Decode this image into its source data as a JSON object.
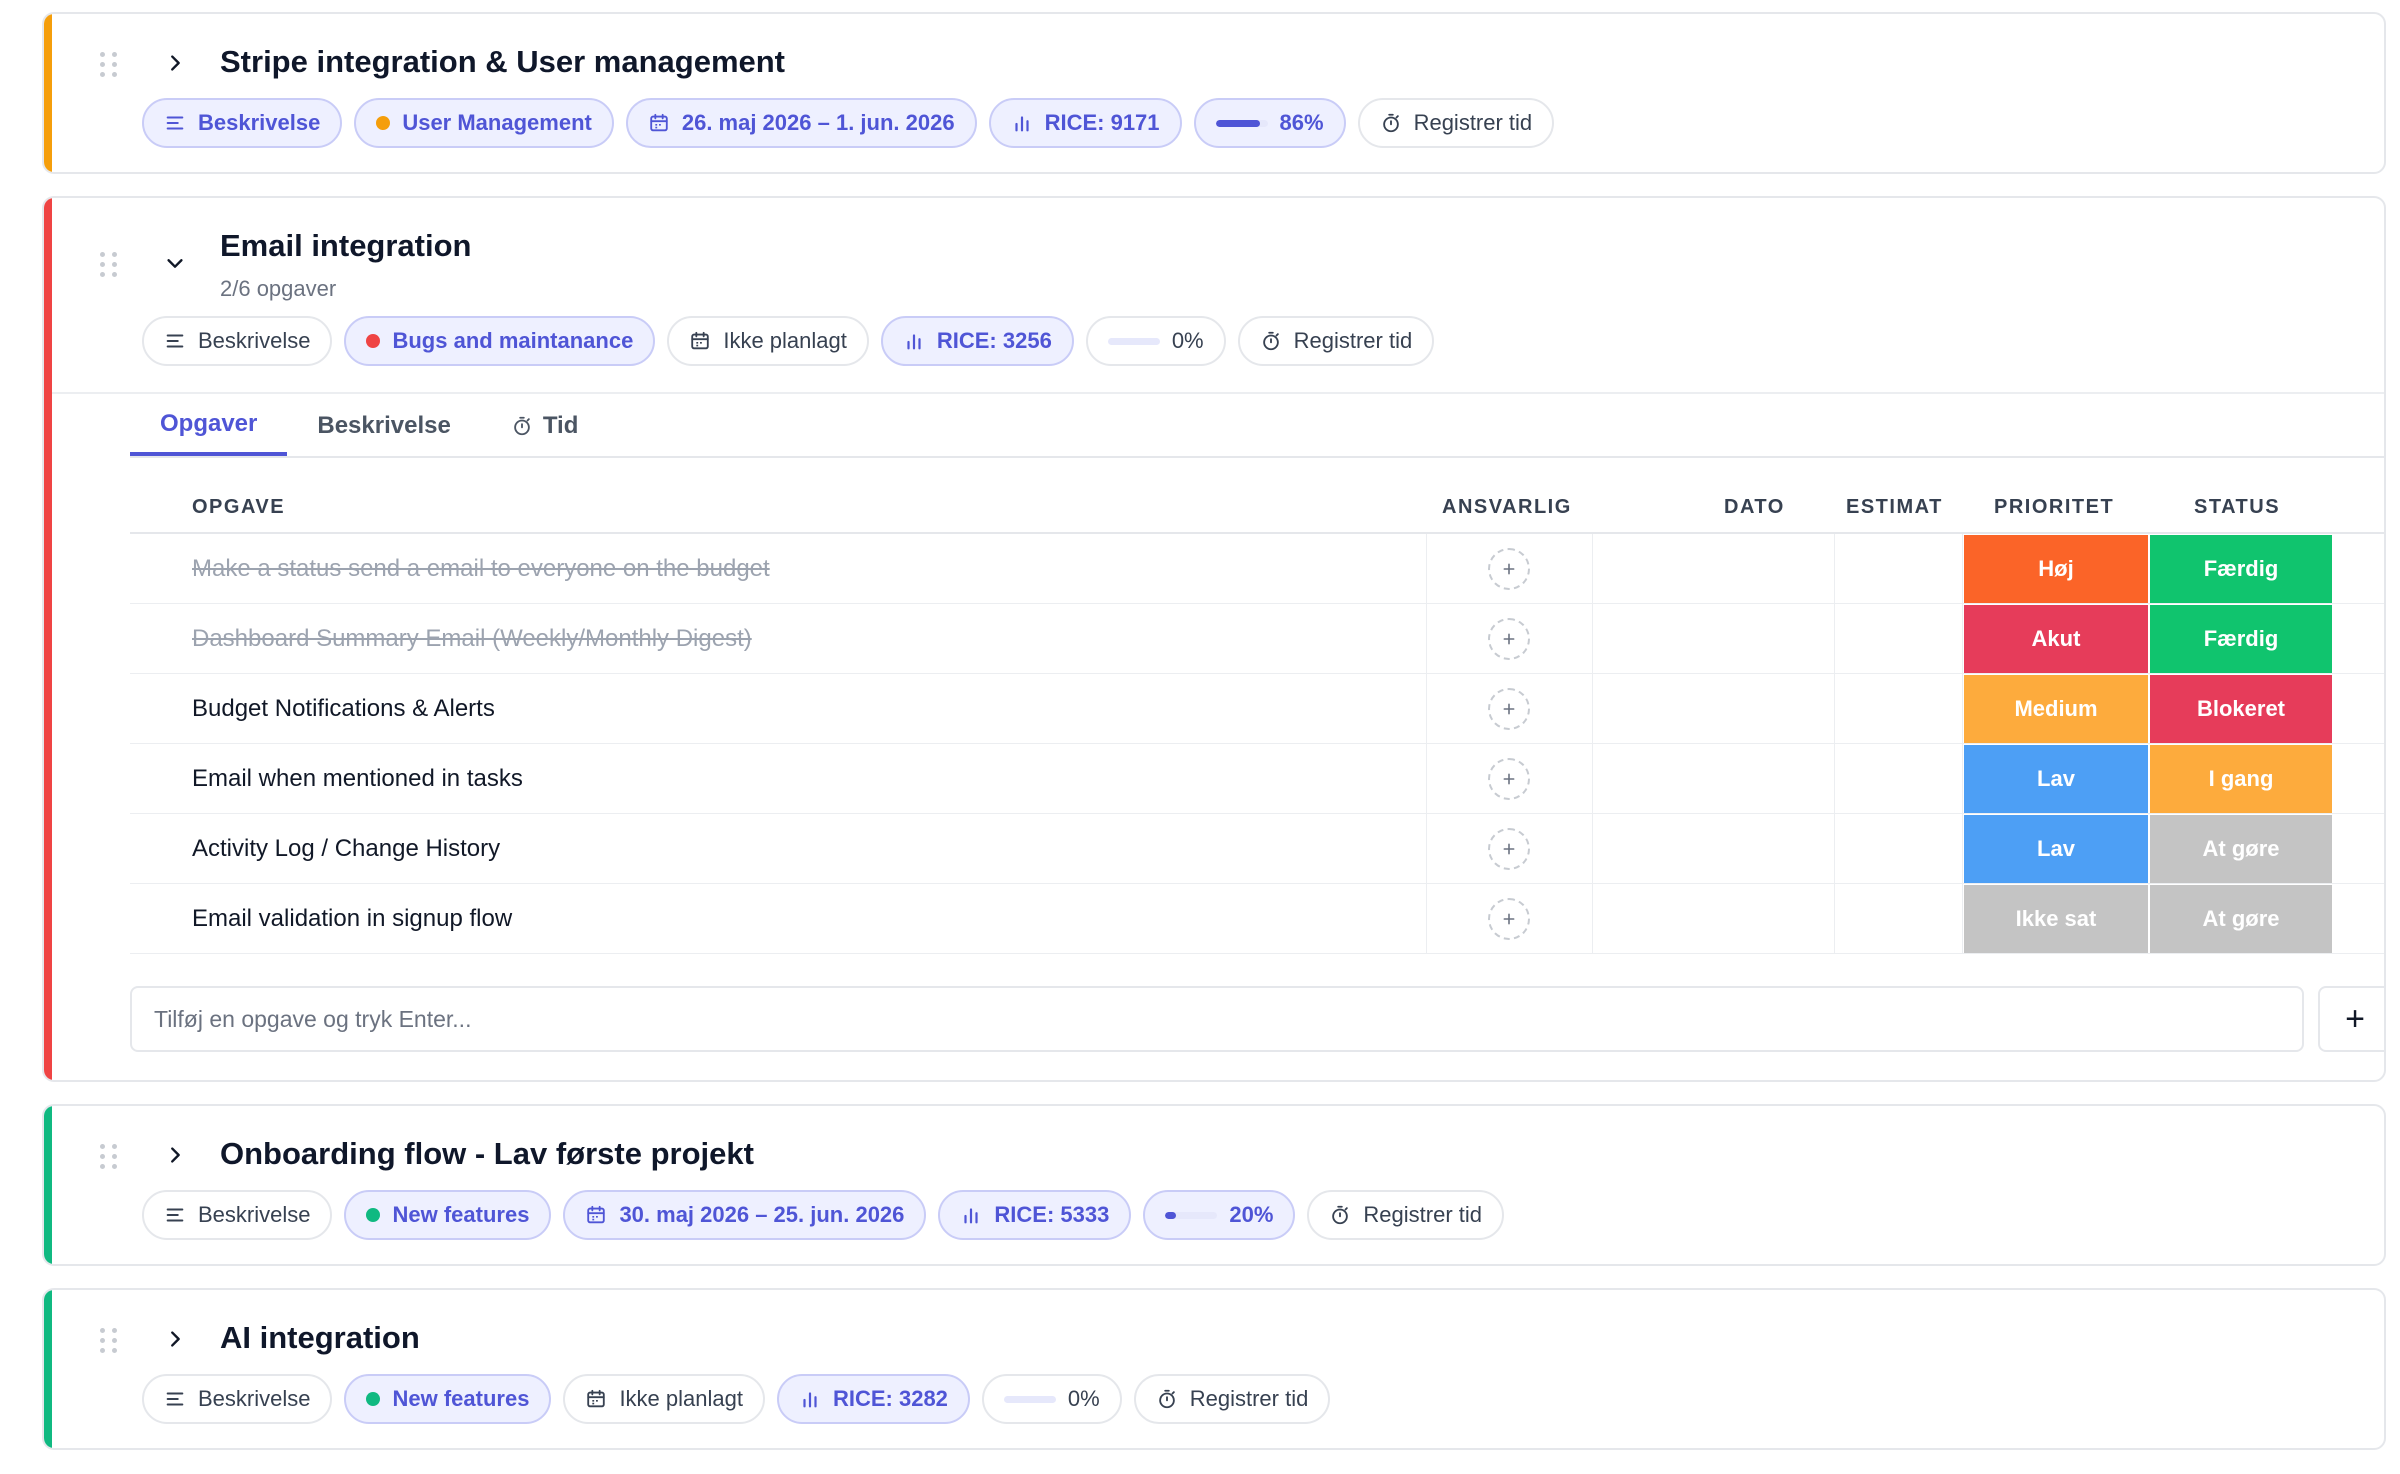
{
  "colors": {
    "accent": "#4f55d6",
    "orange_stripe": "#f59e0b",
    "red_stripe": "#ef4444",
    "green_stripe": "#10b981"
  },
  "cards": [
    {
      "title": "Stripe integration & User management",
      "chips": {
        "description": "Beskrivelse",
        "category": "User Management",
        "category_color": "#f59e0b",
        "dates": "26. maj 2026 – 1. jun. 2026",
        "rice": "RICE: 9171",
        "progress": "86%",
        "progress_value": 0.86,
        "time": "Registrer tid"
      }
    },
    {
      "title": "Email integration",
      "subtitle": "2/6 opgaver",
      "chips": {
        "description": "Beskrivelse",
        "category": "Bugs and maintanance",
        "category_color": "#ef4444",
        "dates": "Ikke planlagt",
        "rice": "RICE: 3256",
        "progress": "0%",
        "progress_value": 0,
        "time": "Registrer tid"
      },
      "tabs": [
        "Opgaver",
        "Beskrivelse",
        "Tid"
      ],
      "table": {
        "headers": {
          "task": "OPGAVE",
          "assignee": "ANSVARLIG",
          "date": "DATO",
          "estimate": "ESTIMAT",
          "priority": "PRIORITET",
          "status": "STATUS"
        },
        "rows": [
          {
            "name": "Make a status send a email to everyone on the budget",
            "done": true,
            "priority": "Høj",
            "priority_color": "#fb6428",
            "status": "Færdig",
            "status_color": "#10c46e"
          },
          {
            "name": "Dashboard Summary Email (Weekly/Monthly Digest)",
            "done": true,
            "priority": "Akut",
            "priority_color": "#e63c5a",
            "status": "Færdig",
            "status_color": "#10c46e"
          },
          {
            "name": "Budget Notifications & Alerts",
            "done": false,
            "priority": "Medium",
            "priority_color": "#fdab3d",
            "status": "Blokeret",
            "status_color": "#e63c5a"
          },
          {
            "name": "Email when mentioned in tasks",
            "done": false,
            "priority": "Lav",
            "priority_color": "#4d9ff5",
            "status": "I gang",
            "status_color": "#fdab3d"
          },
          {
            "name": "Activity Log / Change History",
            "done": false,
            "priority": "Lav",
            "priority_color": "#4d9ff5",
            "status": "At gøre",
            "status_color": "#c4c4c4"
          },
          {
            "name": "Email validation in signup flow",
            "done": false,
            "priority": "Ikke sat",
            "priority_color": "#c4c4c4",
            "status": "At gøre",
            "status_color": "#c4c4c4"
          }
        ]
      },
      "add_task_placeholder": "Tilføj en opgave og tryk Enter...",
      "add_button": "+"
    },
    {
      "title": "Onboarding flow - Lav første projekt",
      "chips": {
        "description": "Beskrivelse",
        "category": "New features",
        "category_color": "#10b981",
        "dates": "30. maj 2026 – 25. jun. 2026",
        "rice": "RICE: 5333",
        "progress": "20%",
        "progress_value": 0.2,
        "time": "Registrer tid"
      }
    },
    {
      "title": "AI integration",
      "chips": {
        "description": "Beskrivelse",
        "category": "New features",
        "category_color": "#10b981",
        "dates": "Ikke planlagt",
        "rice": "RICE: 3282",
        "progress": "0%",
        "progress_value": 0,
        "time": "Registrer tid"
      }
    }
  ]
}
